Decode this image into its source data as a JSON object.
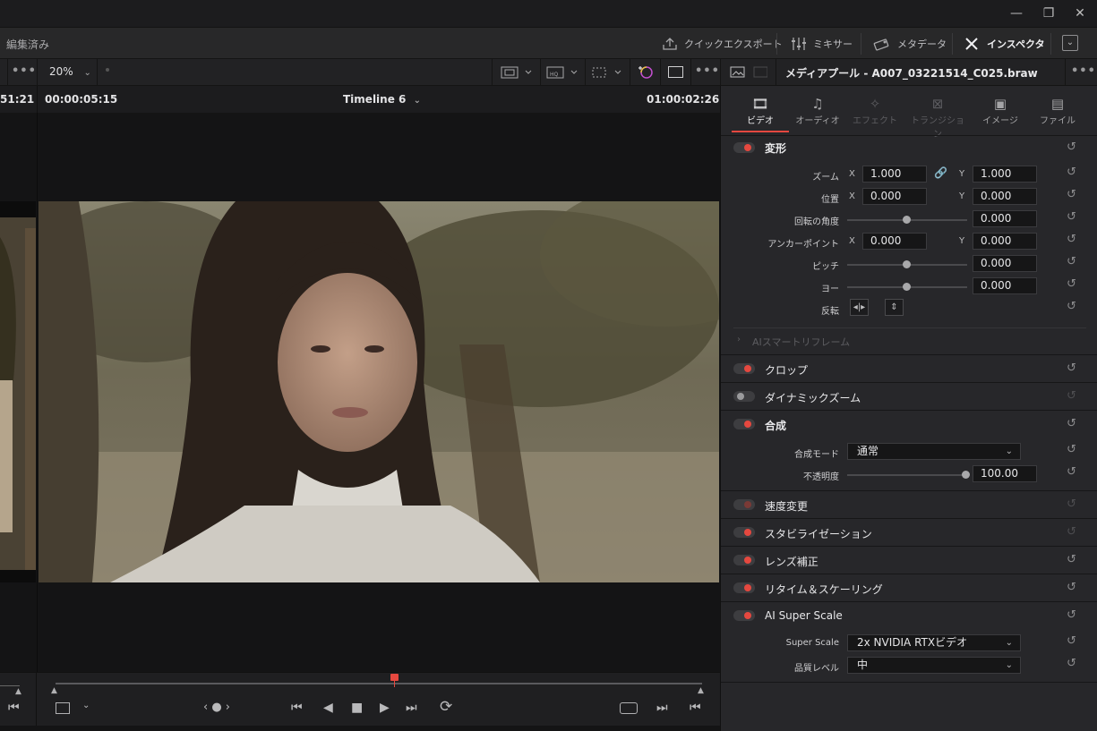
{
  "window": {
    "minimize": "—",
    "restore": "❐",
    "close": "✕"
  },
  "menubar": {
    "title": "編集済み",
    "quick_export": "クイックエクスポート",
    "mixer": "ミキサー",
    "metadata": "メタデータ",
    "inspector": "インスペクタ"
  },
  "toolbar": {
    "zoom": "20%",
    "dots": "•••",
    "clip_title": "メディアプール - A007_03221514_C025.braw"
  },
  "timecode": {
    "left_partial": "51:21",
    "source": "00:00:05:15",
    "timeline": "Timeline 6",
    "record": "01:00:02:26"
  },
  "inspector": {
    "tabs": [
      {
        "icon": "film",
        "label": "ビデオ",
        "active": true
      },
      {
        "icon": "music",
        "label": "オーディオ"
      },
      {
        "icon": "wand",
        "label": "エフェクト"
      },
      {
        "icon": "transition",
        "label": "トランジション"
      },
      {
        "icon": "image",
        "label": "イメージ"
      },
      {
        "icon": "file",
        "label": "ファイル"
      }
    ],
    "transform": {
      "title": "変形",
      "zoom_label": "ズーム",
      "zoom_x": "1.000",
      "zoom_y": "1.000",
      "position_label": "位置",
      "position_x": "0.000",
      "position_y": "0.000",
      "rotation_label": "回転の角度",
      "rotation": "0.000",
      "anchor_label": "アンカーポイント",
      "anchor_x": "0.000",
      "anchor_y": "0.000",
      "pitch_label": "ピッチ",
      "pitch": "0.000",
      "yaw_label": "ヨー",
      "yaw": "0.000",
      "flip_label": "反転",
      "x": "X",
      "y": "Y"
    },
    "ai_reframe": "AIスマートリフレーム",
    "crop": "クロップ",
    "dynamic_zoom": "ダイナミックズーム",
    "composite": {
      "title": "合成",
      "mode_label": "合成モード",
      "mode": "通常",
      "opacity_label": "不透明度",
      "opacity": "100.00"
    },
    "speed": "速度変更",
    "stabilization": "スタビライゼーション",
    "lens": "レンズ補正",
    "retime": "リタイム＆スケーリング",
    "super_scale": {
      "title": "AI Super Scale",
      "scale_label": "Super Scale",
      "scale": "2x NVIDIA RTXビデオ",
      "quality_label": "品質レベル",
      "quality": "中"
    }
  },
  "colors": {
    "accent": "#e5483f",
    "active_tab_underline": "#e5483f"
  }
}
